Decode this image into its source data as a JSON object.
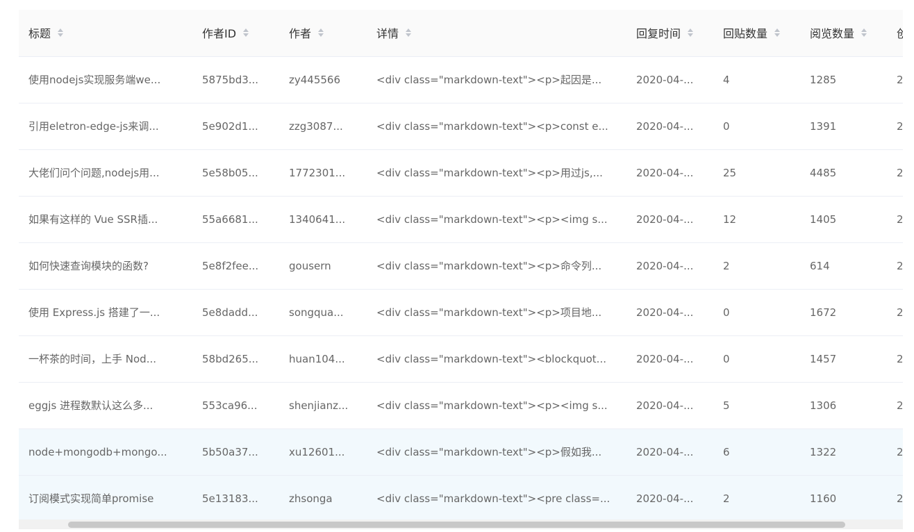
{
  "table": {
    "columns": [
      {
        "key": "title",
        "label": "标题"
      },
      {
        "key": "author_id",
        "label": "作者ID"
      },
      {
        "key": "author",
        "label": "作者"
      },
      {
        "key": "detail",
        "label": "详情"
      },
      {
        "key": "reply_time",
        "label": "回复时间"
      },
      {
        "key": "reply_count",
        "label": "回贴数量"
      },
      {
        "key": "visit_count",
        "label": "阅览数量"
      },
      {
        "key": "create_time",
        "label": "创"
      }
    ],
    "rows": [
      {
        "title": "使用nodejs实现服务端we...",
        "author_id": "5875bd3...",
        "author": "zy445566",
        "detail": "<div class=\"markdown-text\"><p>起因是...",
        "reply_time": "2020-04-...",
        "reply_count": "4",
        "visit_count": "1285",
        "create_time": "2"
      },
      {
        "title": "引用eletron-edge-js来调...",
        "author_id": "5e902d1...",
        "author": "zzg3087...",
        "detail": "<div class=\"markdown-text\"><p>const e...",
        "reply_time": "2020-04-...",
        "reply_count": "0",
        "visit_count": "1391",
        "create_time": "2"
      },
      {
        "title": "大佬们问个问题,nodejs用...",
        "author_id": "5e58b05...",
        "author": "1772301...",
        "detail": "<div class=\"markdown-text\"><p>用过js,...",
        "reply_time": "2020-04-...",
        "reply_count": "25",
        "visit_count": "4485",
        "create_time": "2"
      },
      {
        "title": "如果有这样的 Vue SSR插...",
        "author_id": "55a6681...",
        "author": "1340641...",
        "detail": "<div class=\"markdown-text\"><p><img s...",
        "reply_time": "2020-04-...",
        "reply_count": "12",
        "visit_count": "1405",
        "create_time": "2"
      },
      {
        "title": "如何快速查询模块的函数?",
        "author_id": "5e8f2fee...",
        "author": "gousern",
        "detail": "<div class=\"markdown-text\"><p>命令列...",
        "reply_time": "2020-04-...",
        "reply_count": "2",
        "visit_count": "614",
        "create_time": "2"
      },
      {
        "title": "使用 Express.js 搭建了一...",
        "author_id": "5e8dadd...",
        "author": "songqua...",
        "detail": "<div class=\"markdown-text\"><p>项目地...",
        "reply_time": "2020-04-...",
        "reply_count": "0",
        "visit_count": "1672",
        "create_time": "2"
      },
      {
        "title": "一杯茶的时间，上手 Nod...",
        "author_id": "58bd265...",
        "author": "huan104...",
        "detail": "<div class=\"markdown-text\"><blockquot...",
        "reply_time": "2020-04-...",
        "reply_count": "0",
        "visit_count": "1457",
        "create_time": "2"
      },
      {
        "title": "eggjs 进程数默认这么多...",
        "author_id": "553ca96...",
        "author": "shenjianz...",
        "detail": "<div class=\"markdown-text\"><p><img s...",
        "reply_time": "2020-04-...",
        "reply_count": "5",
        "visit_count": "1306",
        "create_time": "2"
      },
      {
        "title": "node+mongodb+mongo...",
        "author_id": "5b50a37...",
        "author": "xu12601...",
        "detail": "<div class=\"markdown-text\"><p>假如我...",
        "reply_time": "2020-04-...",
        "reply_count": "6",
        "visit_count": "1322",
        "create_time": "2"
      },
      {
        "title": "订阅模式实现简单promise",
        "author_id": "5e13183...",
        "author": "zhsonga",
        "detail": "<div class=\"markdown-text\"><pre class=...",
        "reply_time": "2020-04-...",
        "reply_count": "2",
        "visit_count": "1160",
        "create_time": "2"
      }
    ]
  },
  "colors": {
    "header_bg": "#fafafa",
    "row_highlight": "#f2f9fd",
    "border": "#ebeef5",
    "sort_icon": "#c0c4cc",
    "scrollbar_thumb": "#c8c8c8"
  },
  "icons": {
    "sort": "sort-caret-icon"
  }
}
